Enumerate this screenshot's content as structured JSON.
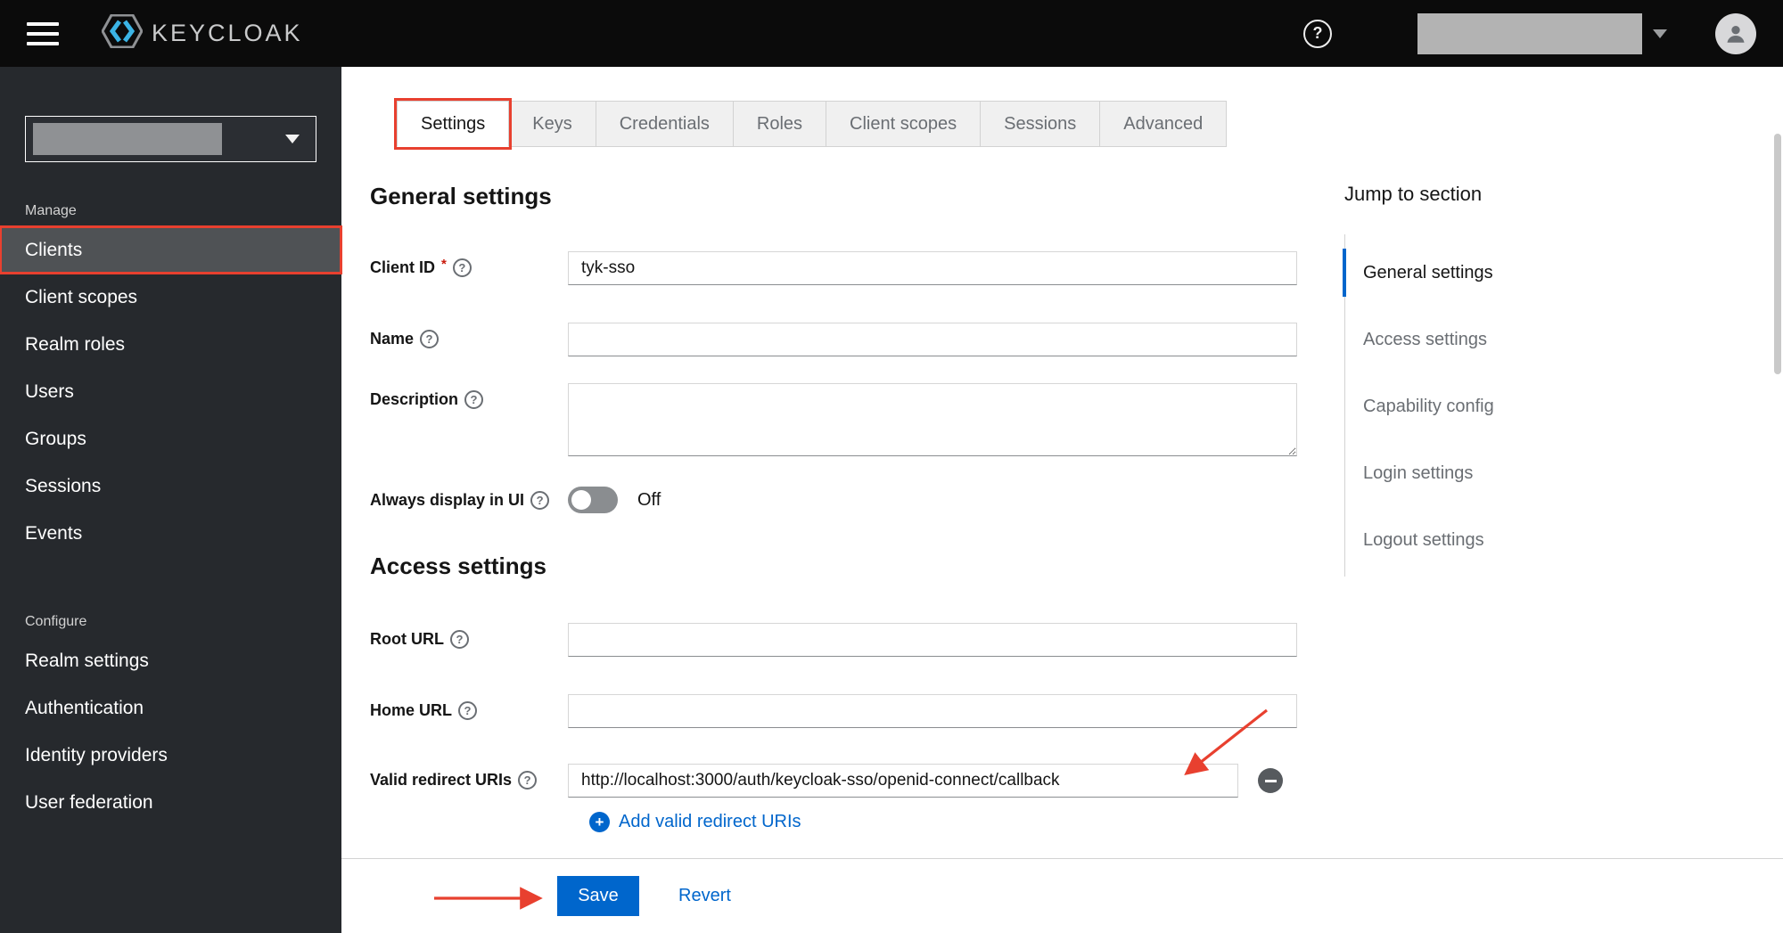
{
  "colors": {
    "accent_blue": "#0066cc",
    "annotation_red": "#e8402f",
    "masthead_bg": "#0b0b0b",
    "sidebar_bg": "#26292d"
  },
  "icons": {
    "question": "?",
    "plus": "+"
  },
  "header": {
    "brand": "KEYCLOAK"
  },
  "sidebar": {
    "manage_label": "Manage",
    "manage_items": [
      "Clients",
      "Client scopes",
      "Realm roles",
      "Users",
      "Groups",
      "Sessions",
      "Events"
    ],
    "configure_label": "Configure",
    "configure_items": [
      "Realm settings",
      "Authentication",
      "Identity providers",
      "User federation"
    ]
  },
  "tabs": {
    "items": [
      "Settings",
      "Keys",
      "Credentials",
      "Roles",
      "Client scopes",
      "Sessions",
      "Advanced"
    ],
    "active": "Settings"
  },
  "form": {
    "general_heading": "General settings",
    "client_id": {
      "label": "Client ID",
      "required": "*",
      "value": "tyk-sso"
    },
    "name": {
      "label": "Name",
      "value": ""
    },
    "description": {
      "label": "Description",
      "value": ""
    },
    "always_display": {
      "label": "Always display in UI",
      "state": "Off"
    },
    "access_heading": "Access settings",
    "root_url": {
      "label": "Root URL",
      "value": ""
    },
    "home_url": {
      "label": "Home URL",
      "value": ""
    },
    "valid_redirect": {
      "label": "Valid redirect URIs",
      "value": "http://localhost:3000/auth/keycloak-sso/openid-connect/callback"
    },
    "add_redirect_label": "Add valid redirect URIs"
  },
  "jump": {
    "title": "Jump to section",
    "items": [
      "General settings",
      "Access settings",
      "Capability config",
      "Login settings",
      "Logout settings"
    ],
    "active": "General settings"
  },
  "actions": {
    "save": "Save",
    "revert": "Revert"
  }
}
